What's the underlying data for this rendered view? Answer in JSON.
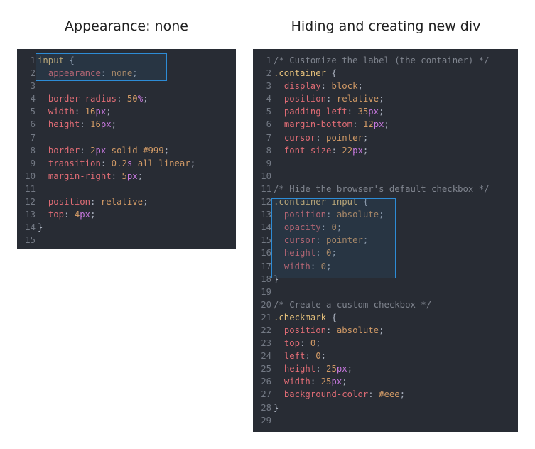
{
  "captions": {
    "left": "Appearance: none",
    "right": "Hiding and creating new div"
  },
  "left_panel": {
    "lines": [
      {
        "n": "1",
        "t": [
          [
            "sel",
            "input"
          ],
          [
            "punc",
            " {"
          ]
        ]
      },
      {
        "n": "2",
        "t": [
          [
            "punc",
            "  "
          ],
          [
            "prop",
            "appearance"
          ],
          [
            "punc",
            ": "
          ],
          [
            "kw",
            "none"
          ],
          [
            "punc",
            ";"
          ]
        ]
      },
      {
        "n": "3",
        "t": []
      },
      {
        "n": "4",
        "t": [
          [
            "punc",
            "  "
          ],
          [
            "prop",
            "border-radius"
          ],
          [
            "punc",
            ": "
          ],
          [
            "val",
            "50"
          ],
          [
            "unit",
            "%"
          ],
          [
            "punc",
            ";"
          ]
        ]
      },
      {
        "n": "5",
        "t": [
          [
            "punc",
            "  "
          ],
          [
            "prop",
            "width"
          ],
          [
            "punc",
            ": "
          ],
          [
            "val",
            "16"
          ],
          [
            "unit",
            "px"
          ],
          [
            "punc",
            ";"
          ]
        ]
      },
      {
        "n": "6",
        "t": [
          [
            "punc",
            "  "
          ],
          [
            "prop",
            "height"
          ],
          [
            "punc",
            ": "
          ],
          [
            "val",
            "16"
          ],
          [
            "unit",
            "px"
          ],
          [
            "punc",
            ";"
          ]
        ]
      },
      {
        "n": "7",
        "t": []
      },
      {
        "n": "8",
        "t": [
          [
            "punc",
            "  "
          ],
          [
            "prop",
            "border"
          ],
          [
            "punc",
            ": "
          ],
          [
            "val",
            "2"
          ],
          [
            "unit",
            "px"
          ],
          [
            "kw",
            " solid "
          ],
          [
            "hex",
            "#999"
          ],
          [
            "punc",
            ";"
          ]
        ]
      },
      {
        "n": "9",
        "t": [
          [
            "punc",
            "  "
          ],
          [
            "prop",
            "transition"
          ],
          [
            "punc",
            ": "
          ],
          [
            "val",
            "0.2"
          ],
          [
            "unit",
            "s"
          ],
          [
            "kw",
            " all linear"
          ],
          [
            "punc",
            ";"
          ]
        ]
      },
      {
        "n": "10",
        "t": [
          [
            "punc",
            "  "
          ],
          [
            "prop",
            "margin-right"
          ],
          [
            "punc",
            ": "
          ],
          [
            "val",
            "5"
          ],
          [
            "unit",
            "px"
          ],
          [
            "punc",
            ";"
          ]
        ]
      },
      {
        "n": "11",
        "t": []
      },
      {
        "n": "12",
        "t": [
          [
            "punc",
            "  "
          ],
          [
            "prop",
            "position"
          ],
          [
            "punc",
            ": "
          ],
          [
            "kw",
            "relative"
          ],
          [
            "punc",
            ";"
          ]
        ]
      },
      {
        "n": "13",
        "t": [
          [
            "punc",
            "  "
          ],
          [
            "prop",
            "top"
          ],
          [
            "punc",
            ": "
          ],
          [
            "val",
            "4"
          ],
          [
            "unit",
            "px"
          ],
          [
            "punc",
            ";"
          ]
        ]
      },
      {
        "n": "14",
        "t": [
          [
            "punc",
            "}"
          ]
        ]
      },
      {
        "n": "15",
        "t": []
      }
    ]
  },
  "right_panel": {
    "lines": [
      {
        "n": "1",
        "t": [
          [
            "comment",
            "/* Customize the label (the container) */"
          ]
        ]
      },
      {
        "n": "2",
        "t": [
          [
            "sel",
            ".container"
          ],
          [
            "punc",
            " {"
          ]
        ]
      },
      {
        "n": "3",
        "t": [
          [
            "punc",
            "  "
          ],
          [
            "prop",
            "display"
          ],
          [
            "punc",
            ": "
          ],
          [
            "kw",
            "block"
          ],
          [
            "punc",
            ";"
          ]
        ]
      },
      {
        "n": "4",
        "t": [
          [
            "punc",
            "  "
          ],
          [
            "prop",
            "position"
          ],
          [
            "punc",
            ": "
          ],
          [
            "kw",
            "relative"
          ],
          [
            "punc",
            ";"
          ]
        ]
      },
      {
        "n": "5",
        "t": [
          [
            "punc",
            "  "
          ],
          [
            "prop",
            "padding-left"
          ],
          [
            "punc",
            ": "
          ],
          [
            "val",
            "35"
          ],
          [
            "unit",
            "px"
          ],
          [
            "punc",
            ";"
          ]
        ]
      },
      {
        "n": "6",
        "t": [
          [
            "punc",
            "  "
          ],
          [
            "prop",
            "margin-bottom"
          ],
          [
            "punc",
            ": "
          ],
          [
            "val",
            "12"
          ],
          [
            "unit",
            "px"
          ],
          [
            "punc",
            ";"
          ]
        ]
      },
      {
        "n": "7",
        "t": [
          [
            "punc",
            "  "
          ],
          [
            "prop",
            "cursor"
          ],
          [
            "punc",
            ": "
          ],
          [
            "kw",
            "pointer"
          ],
          [
            "punc",
            ";"
          ]
        ]
      },
      {
        "n": "8",
        "t": [
          [
            "punc",
            "  "
          ],
          [
            "prop",
            "font-size"
          ],
          [
            "punc",
            ": "
          ],
          [
            "val",
            "22"
          ],
          [
            "unit",
            "px"
          ],
          [
            "punc",
            ";"
          ]
        ]
      },
      {
        "n": "9",
        "t": []
      },
      {
        "n": "10",
        "t": []
      },
      {
        "n": "11",
        "t": [
          [
            "comment",
            "/* Hide the browser's default checkbox */"
          ]
        ]
      },
      {
        "n": "12",
        "t": [
          [
            "sel",
            ".container input"
          ],
          [
            "punc",
            " {"
          ]
        ]
      },
      {
        "n": "13",
        "t": [
          [
            "punc",
            "  "
          ],
          [
            "prop",
            "position"
          ],
          [
            "punc",
            ": "
          ],
          [
            "kw",
            "absolute"
          ],
          [
            "punc",
            ";"
          ]
        ]
      },
      {
        "n": "14",
        "t": [
          [
            "punc",
            "  "
          ],
          [
            "prop",
            "opacity"
          ],
          [
            "punc",
            ": "
          ],
          [
            "val",
            "0"
          ],
          [
            "punc",
            ";"
          ]
        ]
      },
      {
        "n": "15",
        "t": [
          [
            "punc",
            "  "
          ],
          [
            "prop",
            "cursor"
          ],
          [
            "punc",
            ": "
          ],
          [
            "kw",
            "pointer"
          ],
          [
            "punc",
            ";"
          ]
        ]
      },
      {
        "n": "16",
        "t": [
          [
            "punc",
            "  "
          ],
          [
            "prop",
            "height"
          ],
          [
            "punc",
            ": "
          ],
          [
            "val",
            "0"
          ],
          [
            "punc",
            ";"
          ]
        ]
      },
      {
        "n": "17",
        "t": [
          [
            "punc",
            "  "
          ],
          [
            "prop",
            "width"
          ],
          [
            "punc",
            ": "
          ],
          [
            "val",
            "0"
          ],
          [
            "punc",
            ";"
          ]
        ]
      },
      {
        "n": "18",
        "t": [
          [
            "punc",
            "}"
          ]
        ]
      },
      {
        "n": "19",
        "t": []
      },
      {
        "n": "20",
        "t": [
          [
            "comment",
            "/* Create a custom checkbox */"
          ]
        ]
      },
      {
        "n": "21",
        "t": [
          [
            "sel",
            ".checkmark"
          ],
          [
            "punc",
            " {"
          ]
        ]
      },
      {
        "n": "22",
        "t": [
          [
            "punc",
            "  "
          ],
          [
            "prop",
            "position"
          ],
          [
            "punc",
            ": "
          ],
          [
            "kw",
            "absolute"
          ],
          [
            "punc",
            ";"
          ]
        ]
      },
      {
        "n": "23",
        "t": [
          [
            "punc",
            "  "
          ],
          [
            "prop",
            "top"
          ],
          [
            "punc",
            ": "
          ],
          [
            "val",
            "0"
          ],
          [
            "punc",
            ";"
          ]
        ]
      },
      {
        "n": "24",
        "t": [
          [
            "punc",
            "  "
          ],
          [
            "prop",
            "left"
          ],
          [
            "punc",
            ": "
          ],
          [
            "val",
            "0"
          ],
          [
            "punc",
            ";"
          ]
        ]
      },
      {
        "n": "25",
        "t": [
          [
            "punc",
            "  "
          ],
          [
            "prop",
            "height"
          ],
          [
            "punc",
            ": "
          ],
          [
            "val",
            "25"
          ],
          [
            "unit",
            "px"
          ],
          [
            "punc",
            ";"
          ]
        ]
      },
      {
        "n": "26",
        "t": [
          [
            "punc",
            "  "
          ],
          [
            "prop",
            "width"
          ],
          [
            "punc",
            ": "
          ],
          [
            "val",
            "25"
          ],
          [
            "unit",
            "px"
          ],
          [
            "punc",
            ";"
          ]
        ]
      },
      {
        "n": "27",
        "t": [
          [
            "punc",
            "  "
          ],
          [
            "prop",
            "background-color"
          ],
          [
            "punc",
            ": "
          ],
          [
            "hex",
            "#eee"
          ],
          [
            "punc",
            ";"
          ]
        ]
      },
      {
        "n": "28",
        "t": [
          [
            "punc",
            "}"
          ]
        ]
      },
      {
        "n": "29",
        "t": []
      }
    ]
  },
  "colors": {
    "editor_bg": "#282c34",
    "highlight_border": "#2d8cd6"
  }
}
